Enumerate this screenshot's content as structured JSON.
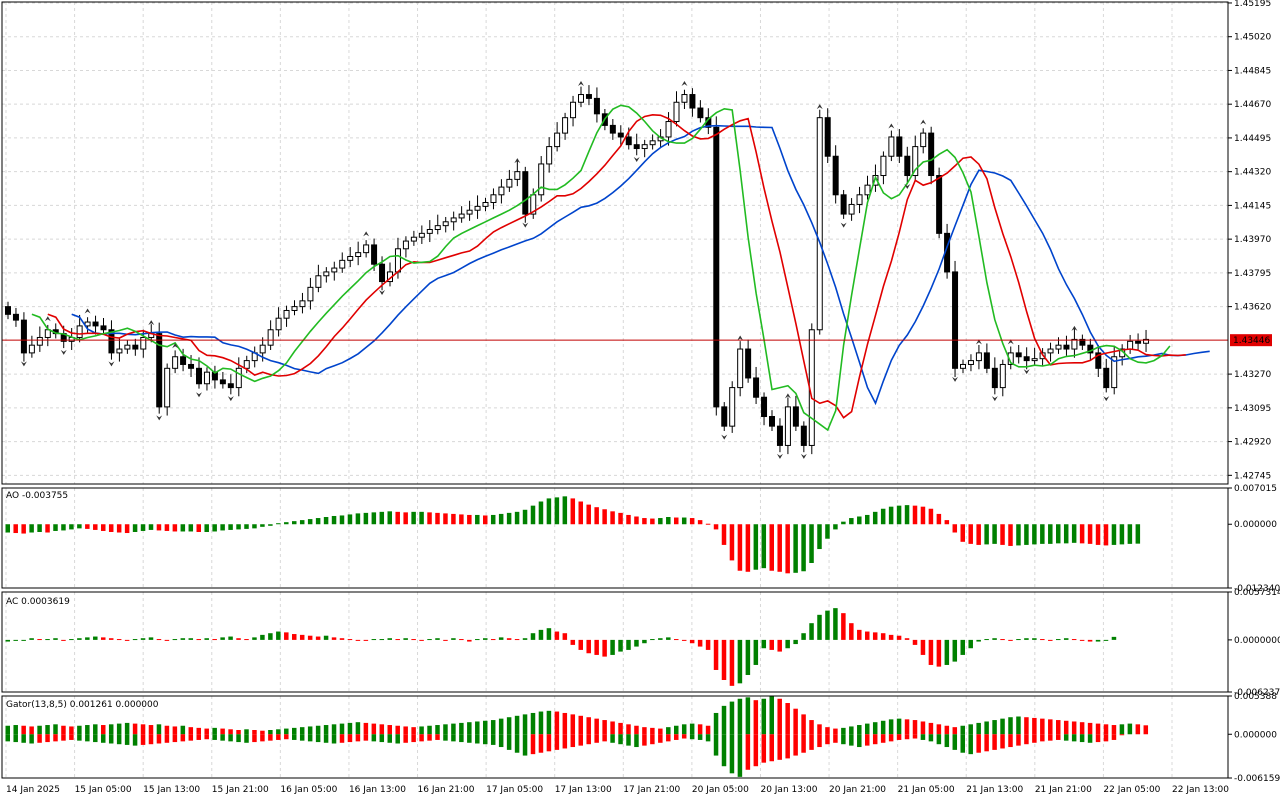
{
  "chart_data": [
    {
      "panel": "price",
      "type": "candlestick",
      "ylim": [
        1.427,
        1.452
      ],
      "yticks": [
        "1.45195",
        "1.45020",
        "1.44845",
        "1.44670",
        "1.44495",
        "1.44320",
        "1.44145",
        "1.43970",
        "1.43795",
        "1.43620",
        "1.43446",
        "1.43270",
        "1.43095",
        "1.42920",
        "1.42745"
      ],
      "current_price": 1.43446,
      "current_label": "1.43446",
      "bars": 144,
      "indicators": [
        "Alligator jaw",
        "Alligator teeth",
        "Alligator lips",
        "Fractals"
      ],
      "close_series": [
        1.4358,
        1.4355,
        1.4338,
        1.4342,
        1.4346,
        1.435,
        1.4348,
        1.4344,
        1.4346,
        1.4352,
        1.4354,
        1.4352,
        1.435,
        1.4338,
        1.434,
        1.4342,
        1.434,
        1.4346,
        1.4348,
        1.431,
        1.433,
        1.4336,
        1.4332,
        1.433,
        1.4322,
        1.4328,
        1.4324,
        1.4322,
        1.432,
        1.433,
        1.4334,
        1.4338,
        1.4342,
        1.435,
        1.4356,
        1.436,
        1.4362,
        1.4365,
        1.4372,
        1.4378,
        1.438,
        1.4382,
        1.4386,
        1.4388,
        1.439,
        1.4394,
        1.4384,
        1.4375,
        1.438,
        1.4392,
        1.4396,
        1.4398,
        1.44,
        1.4402,
        1.4404,
        1.4406,
        1.4408,
        1.441,
        1.4412,
        1.4414,
        1.4416,
        1.442,
        1.4424,
        1.4428,
        1.4432,
        1.441,
        1.442,
        1.4436,
        1.4445,
        1.4452,
        1.446,
        1.4468,
        1.4472,
        1.447,
        1.4462,
        1.4456,
        1.4452,
        1.445,
        1.4446,
        1.4444,
        1.4446,
        1.4448,
        1.445,
        1.4458,
        1.4468,
        1.4472,
        1.4465,
        1.446,
        1.4455,
        1.431,
        1.43,
        1.432,
        1.434,
        1.4325,
        1.4315,
        1.4305,
        1.43,
        1.429,
        1.431,
        1.43,
        1.429,
        1.435,
        1.446,
        1.444,
        1.442,
        1.441,
        1.4415,
        1.442,
        1.4425,
        1.443,
        1.444,
        1.445,
        1.444,
        1.443,
        1.4445,
        1.4452,
        1.443,
        1.44,
        1.438,
        1.433,
        1.4332,
        1.4334,
        1.4338,
        1.433,
        1.432,
        1.4332,
        1.4338,
        1.4336,
        1.4334,
        1.4335,
        1.4338,
        1.434,
        1.4342,
        1.434,
        1.4345,
        1.4342,
        1.4338,
        1.433,
        1.432,
        1.4336,
        1.434,
        1.4344,
        1.4343,
        1.4345
      ]
    },
    {
      "panel": "AO",
      "type": "bar",
      "label": "AO -0.003755",
      "ylim": [
        -0.01234,
        0.007015
      ],
      "yticks": [
        "0.007015",
        "0.000000",
        "-0.012340"
      ],
      "values": [
        -0.0016,
        -0.0017,
        -0.0018,
        -0.0016,
        -0.0015,
        -0.0016,
        -0.0013,
        -0.0012,
        -0.001,
        -0.0008,
        -0.0009,
        -0.0011,
        -0.0013,
        -0.0015,
        -0.0016,
        -0.0017,
        -0.0015,
        -0.0013,
        -0.0011,
        -0.0012,
        -0.0013,
        -0.0014,
        -0.0014,
        -0.0014,
        -0.0015,
        -0.0015,
        -0.0014,
        -0.0012,
        -0.0011,
        -0.001,
        -0.0009,
        -0.0008,
        -0.0005,
        -0.0003,
        0.0002,
        0.0004,
        0.0006,
        0.0008,
        0.001,
        0.0012,
        0.0014,
        0.0016,
        0.0017,
        0.0019,
        0.0021,
        0.0022,
        0.0023,
        0.0024,
        0.0025,
        0.0024,
        0.0023,
        0.0024,
        0.0024,
        0.0023,
        0.0022,
        0.0021,
        0.002,
        0.0019,
        0.0018,
        0.0018,
        0.0017,
        0.0018,
        0.002,
        0.0022,
        0.0024,
        0.0028,
        0.0036,
        0.0044,
        0.005,
        0.0052,
        0.0054,
        0.005,
        0.0044,
        0.0038,
        0.0033,
        0.0029,
        0.0025,
        0.0022,
        0.0018,
        0.0015,
        0.0012,
        0.0011,
        0.0012,
        0.0014,
        0.0013,
        0.0013,
        0.0012,
        0.0008,
        0.0001,
        -0.001,
        -0.004,
        -0.007,
        -0.009,
        -0.0092,
        -0.0088,
        -0.0085,
        -0.009,
        -0.0092,
        -0.0095,
        -0.0094,
        -0.0091,
        -0.0075,
        -0.0048,
        -0.0028,
        -0.001,
        0.0005,
        0.0012,
        0.0015,
        0.0018,
        0.0024,
        0.003,
        0.0034,
        0.0036,
        0.0037,
        0.0036,
        0.0034,
        0.003,
        0.002,
        0.0008,
        -0.0016,
        -0.0034,
        -0.0038,
        -0.004,
        -0.0039,
        -0.0038,
        -0.004,
        -0.0042,
        -0.0041,
        -0.004,
        -0.0039,
        -0.0038,
        -0.0038,
        -0.0037,
        -0.0037,
        -0.0036,
        -0.0037,
        -0.0038,
        -0.004,
        -0.0041,
        -0.004,
        -0.0039,
        -0.0038,
        -0.003755
      ]
    },
    {
      "panel": "AC",
      "type": "bar",
      "label": "AC 0.0003619",
      "ylim": [
        -0.006237,
        0.0057314
      ],
      "yticks": [
        "0.0057314",
        "0.0000000",
        "-0.0062370"
      ],
      "values": [
        -0.0002,
        -0.0001,
        0.0,
        0.0002,
        0.0001,
        0.0001,
        0.0002,
        -0.0001,
        0.0001,
        0.0002,
        0.0003,
        0.0004,
        0.0003,
        0.0002,
        0.0001,
        -0.0001,
        0.0001,
        0.0002,
        0.0003,
        0.0001,
        -0.0001,
        0.0001,
        0.0002,
        0.0002,
        0.0001,
        0.0002,
        0.0001,
        0.0003,
        0.0004,
        0.0002,
        0.0001,
        0.0003,
        0.0006,
        0.0008,
        0.001,
        0.0009,
        0.0007,
        0.0006,
        0.0005,
        0.0004,
        0.0005,
        0.0003,
        0.0002,
        0.0001,
        0.0,
        -0.0001,
        0.0001,
        0.0001,
        0.0002,
        0.0001,
        0.0002,
        0.0001,
        -0.0001,
        0.0001,
        0.0002,
        -0.0001,
        0.0002,
        0.0001,
        -0.0002,
        0.0001,
        0.0002,
        0.0001,
        0.0003,
        0.0002,
        0.0001,
        0.0002,
        0.0008,
        0.0012,
        0.0014,
        0.001,
        0.0008,
        -0.0006,
        -0.0012,
        -0.0016,
        -0.0018,
        -0.002,
        -0.0018,
        -0.0014,
        -0.0012,
        -0.0008,
        -0.0004,
        0.0001,
        0.0002,
        0.0003,
        0.0001,
        -0.0001,
        -0.0004,
        -0.0008,
        -0.0012,
        -0.0036,
        -0.0048,
        -0.0055,
        -0.0052,
        -0.0042,
        -0.003,
        -0.001,
        -0.0012,
        -0.0014,
        -0.001,
        -0.0005,
        0.0008,
        0.002,
        0.003,
        0.0035,
        0.0038,
        0.0032,
        0.002,
        0.0012,
        0.001,
        0.0009,
        0.0008,
        0.0006,
        0.0005,
        0.0002,
        -0.0006,
        -0.0018,
        -0.003,
        -0.0032,
        -0.003,
        -0.0026,
        -0.0018,
        -0.001,
        -0.0002,
        0.0001,
        0.0002,
        0.0001,
        -0.0001,
        0.0001,
        0.0002,
        0.0002,
        0.0001,
        -0.0001,
        0.0001,
        0.0002,
        0.0001,
        -0.0001,
        -0.0002,
        -0.0002,
        -0.0001,
        0.0003619
      ]
    },
    {
      "panel": "Gator",
      "type": "bar",
      "label": "Gator(13,8,5) 0.001261 0.000000",
      "ylim": [
        -0.006159,
        0.005388
      ],
      "yticks": [
        "0.005388",
        "0.000000",
        "-0.006159"
      ],
      "upper": [
        0.0012,
        0.0013,
        0.0012,
        0.0011,
        0.0012,
        0.0013,
        0.0014,
        0.0012,
        0.0011,
        0.0012,
        0.0013,
        0.0014,
        0.0013,
        0.0014,
        0.0015,
        0.0016,
        0.0015,
        0.0014,
        0.0013,
        0.0014,
        0.0012,
        0.0011,
        0.0012,
        0.001,
        0.0009,
        0.0008,
        0.0009,
        0.0008,
        0.0007,
        0.0006,
        0.0007,
        0.0006,
        0.0005,
        0.0006,
        0.0007,
        0.0008,
        0.0009,
        0.001,
        0.0011,
        0.0012,
        0.0013,
        0.0014,
        0.0015,
        0.0016,
        0.0017,
        0.0016,
        0.0015,
        0.0014,
        0.0013,
        0.0012,
        0.0011,
        0.001,
        0.0011,
        0.0012,
        0.0013,
        0.0014,
        0.0015,
        0.0016,
        0.0017,
        0.0018,
        0.0019,
        0.002,
        0.0022,
        0.0024,
        0.0026,
        0.0028,
        0.003,
        0.0032,
        0.0033,
        0.0032,
        0.003,
        0.0028,
        0.0026,
        0.0024,
        0.0022,
        0.002,
        0.0018,
        0.0016,
        0.0014,
        0.0012,
        0.001,
        0.0009,
        0.0008,
        0.001,
        0.0012,
        0.0014,
        0.0015,
        0.0014,
        0.0012,
        0.003,
        0.004,
        0.0046,
        0.005,
        0.0052,
        0.0048,
        0.005,
        0.0054,
        0.005,
        0.0044,
        0.0036,
        0.0028,
        0.002,
        0.0014,
        0.001,
        0.0008,
        0.0009,
        0.0011,
        0.0013,
        0.0015,
        0.0017,
        0.0019,
        0.0021,
        0.0022,
        0.0021,
        0.002,
        0.0018,
        0.0016,
        0.0014,
        0.0012,
        0.001,
        0.0012,
        0.0014,
        0.0016,
        0.0018,
        0.002,
        0.0022,
        0.0024,
        0.0025,
        0.0024,
        0.0023,
        0.0022,
        0.0021,
        0.002,
        0.0019,
        0.0018,
        0.0017,
        0.0016,
        0.0015,
        0.0014,
        0.0013,
        0.0014,
        0.0015,
        0.0014,
        0.001261
      ],
      "lower": [
        -0.001,
        -0.0011,
        -0.0012,
        -0.0013,
        -0.0012,
        -0.0011,
        -0.001,
        -0.0009,
        -0.0008,
        -0.0009,
        -0.001,
        -0.0011,
        -0.0012,
        -0.0013,
        -0.0014,
        -0.0015,
        -0.0016,
        -0.0015,
        -0.0014,
        -0.0013,
        -0.0012,
        -0.0011,
        -0.001,
        -0.0009,
        -0.0008,
        -0.0007,
        -0.0008,
        -0.0009,
        -0.001,
        -0.0011,
        -0.0012,
        -0.0011,
        -0.001,
        -0.0009,
        -0.0008,
        -0.0007,
        -0.0008,
        -0.0009,
        -0.001,
        -0.0011,
        -0.0012,
        -0.0013,
        -0.0012,
        -0.0011,
        -0.001,
        -0.0009,
        -0.001,
        -0.0011,
        -0.0012,
        -0.0013,
        -0.0012,
        -0.0011,
        -0.001,
        -0.0009,
        -0.0008,
        -0.0009,
        -0.001,
        -0.0011,
        -0.0012,
        -0.0013,
        -0.0014,
        -0.0015,
        -0.0018,
        -0.0022,
        -0.0026,
        -0.003,
        -0.0028,
        -0.0026,
        -0.0024,
        -0.0022,
        -0.002,
        -0.0018,
        -0.0016,
        -0.0014,
        -0.0012,
        -0.001,
        -0.0012,
        -0.0014,
        -0.0016,
        -0.0018,
        -0.0016,
        -0.0014,
        -0.0012,
        -0.001,
        -0.0008,
        -0.0006,
        -0.0007,
        -0.0008,
        -0.001,
        -0.003,
        -0.0045,
        -0.0055,
        -0.006,
        -0.005,
        -0.0045,
        -0.004,
        -0.0038,
        -0.0036,
        -0.0034,
        -0.003,
        -0.0026,
        -0.0022,
        -0.0018,
        -0.0014,
        -0.0012,
        -0.0014,
        -0.0016,
        -0.0018,
        -0.0016,
        -0.0014,
        -0.0012,
        -0.001,
        -0.0008,
        -0.0007,
        -0.0006,
        -0.0008,
        -0.001,
        -0.0014,
        -0.0018,
        -0.0022,
        -0.0026,
        -0.0028,
        -0.0026,
        -0.0024,
        -0.0022,
        -0.002,
        -0.0018,
        -0.0016,
        -0.0014,
        -0.0012,
        -0.001,
        -0.0009,
        -0.0008,
        -0.0009,
        -0.001,
        -0.0011,
        -0.0012,
        -0.0011,
        -0.001,
        -0.0008,
        0.0
      ]
    }
  ],
  "xticks": [
    "14 Jan 2025",
    "15 Jan 05:00",
    "15 Jan 13:00",
    "15 Jan 21:00",
    "16 Jan 05:00",
    "16 Jan 13:00",
    "16 Jan 21:00",
    "17 Jan 05:00",
    "17 Jan 13:00",
    "17 Jan 21:00",
    "20 Jan 05:00",
    "20 Jan 13:00",
    "20 Jan 21:00",
    "21 Jan 05:00",
    "21 Jan 13:00",
    "21 Jan 21:00",
    "22 Jan 05:00",
    "22 Jan 13:00"
  ],
  "colors": {
    "up_bar": "#008000",
    "down_bar": "#ff0000",
    "jaw": "#0044cc",
    "teeth": "#e00000",
    "lips": "#22bb22",
    "grid": "#d8d8d8",
    "price_line": "#c00000",
    "price_label_bg": "#e00000",
    "candle_bear": "#000000"
  }
}
